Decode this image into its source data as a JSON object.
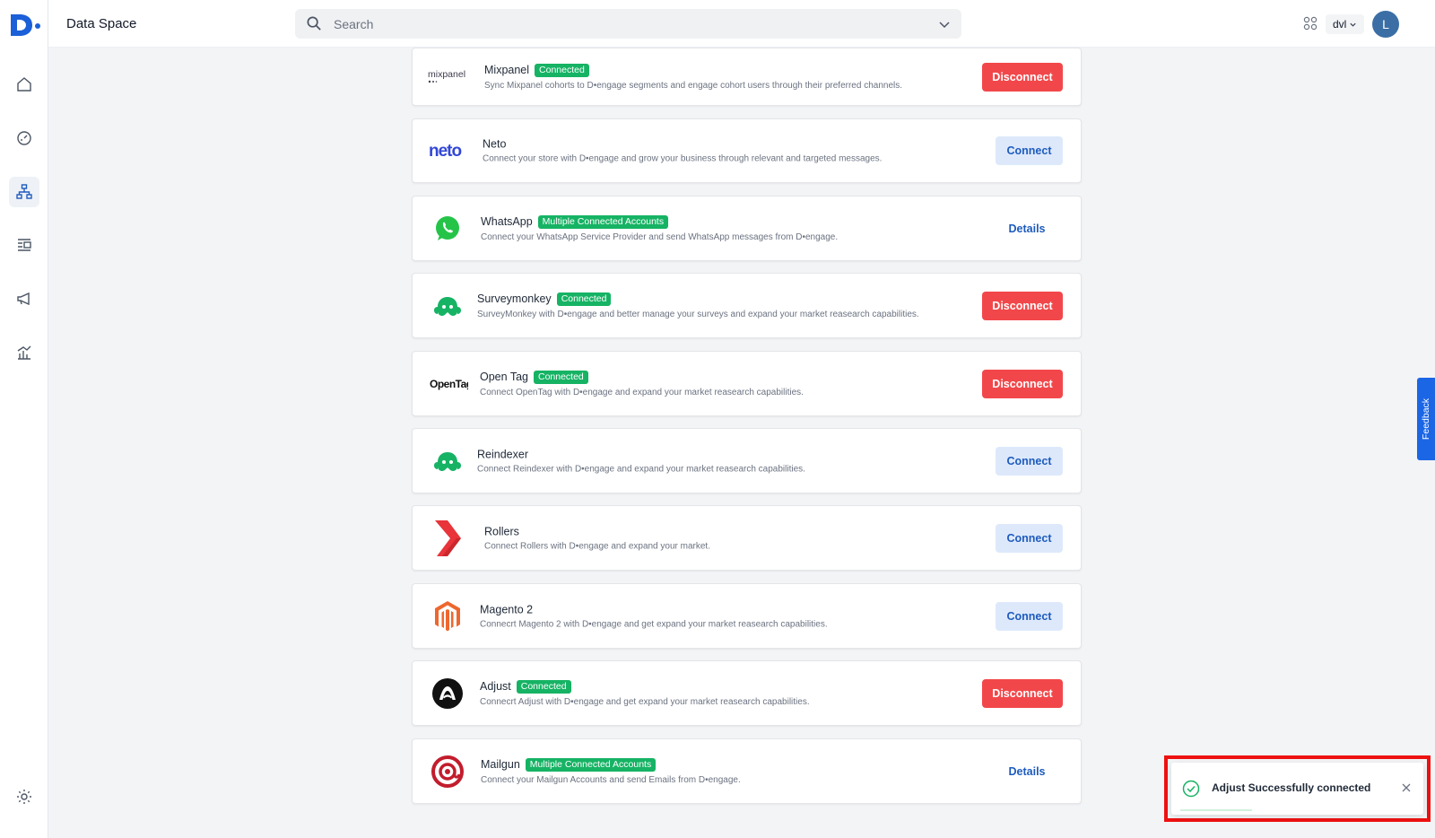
{
  "app": {
    "title": "Data Space"
  },
  "search": {
    "placeholder": "Search"
  },
  "header": {
    "workspace": "dvl",
    "avatar_letter": "L"
  },
  "sidebar": {
    "items": [
      {
        "name": "home",
        "icon": "home-icon"
      },
      {
        "name": "dashboard",
        "icon": "gauge-icon"
      },
      {
        "name": "data-space",
        "icon": "sitemap-icon",
        "active": true
      },
      {
        "name": "content",
        "icon": "list-icon"
      },
      {
        "name": "campaigns",
        "icon": "megaphone-icon"
      },
      {
        "name": "analytics",
        "icon": "bar-chart-icon"
      },
      {
        "name": "settings",
        "icon": "gear-icon"
      }
    ]
  },
  "integrations": [
    {
      "name": "Mixpanel",
      "badge": "Connected",
      "description": "Sync Mixpanel cohorts to D•engage segments and engage cohort users through their preferred channels.",
      "action": "Disconnect",
      "logo": "mixpanel"
    },
    {
      "name": "Neto",
      "badge": "",
      "description": "Connect your store with D•engage and grow your business through relevant and targeted messages.",
      "action": "Connect",
      "logo": "neto"
    },
    {
      "name": "WhatsApp",
      "badge": "Multiple Connected Accounts",
      "description": "Connect your WhatsApp Service Provider and send WhatsApp messages from D•engage.",
      "action": "Details",
      "logo": "whatsapp"
    },
    {
      "name": "Surveymonkey",
      "badge": "Connected",
      "description": "SurveyMonkey with D•engage and better manage your surveys and expand your market reasearch capabilities.",
      "action": "Disconnect",
      "logo": "surveymonkey"
    },
    {
      "name": "Open Tag",
      "badge": "Connected",
      "description": "Connect OpenTag with D•engage and expand your market reasearch capabilities.",
      "action": "Disconnect",
      "logo": "opentag"
    },
    {
      "name": "Reindexer",
      "badge": "",
      "description": "Connect Reindexer with D•engage and expand your market reasearch capabilities.",
      "action": "Connect",
      "logo": "reindexer"
    },
    {
      "name": "Rollers",
      "badge": "",
      "description": "Connect Rollers with D•engage and expand your market.",
      "action": "Connect",
      "logo": "rollers"
    },
    {
      "name": "Magento 2",
      "badge": "",
      "description": "Connecrt Magento 2 with D•engage and get expand your market reasearch capabilities.",
      "action": "Connect",
      "logo": "magento"
    },
    {
      "name": "Adjust",
      "badge": "Connected",
      "description": "Connecrt Adjust with D•engage and get expand your market reasearch capabilities.",
      "action": "Disconnect",
      "logo": "adjust"
    },
    {
      "name": "Mailgun",
      "badge": "Multiple Connected Accounts",
      "description": "Connect your Mailgun Accounts and send Emails from D•engage.",
      "action": "Details",
      "logo": "mailgun"
    }
  ],
  "logos": {
    "mixpanel": "mixpanel",
    "neto": "neto",
    "opentag": "OpenTag"
  },
  "feedback": {
    "label": "Feedback"
  },
  "toast": {
    "message": "Adjust Successfully connected"
  },
  "colors": {
    "connected_badge": "#16b364",
    "disconnect_button": "#f2474a",
    "connect_button_bg": "#dde9fb",
    "link_blue": "#1e5bbd",
    "highlight_outline": "#ee1111"
  }
}
